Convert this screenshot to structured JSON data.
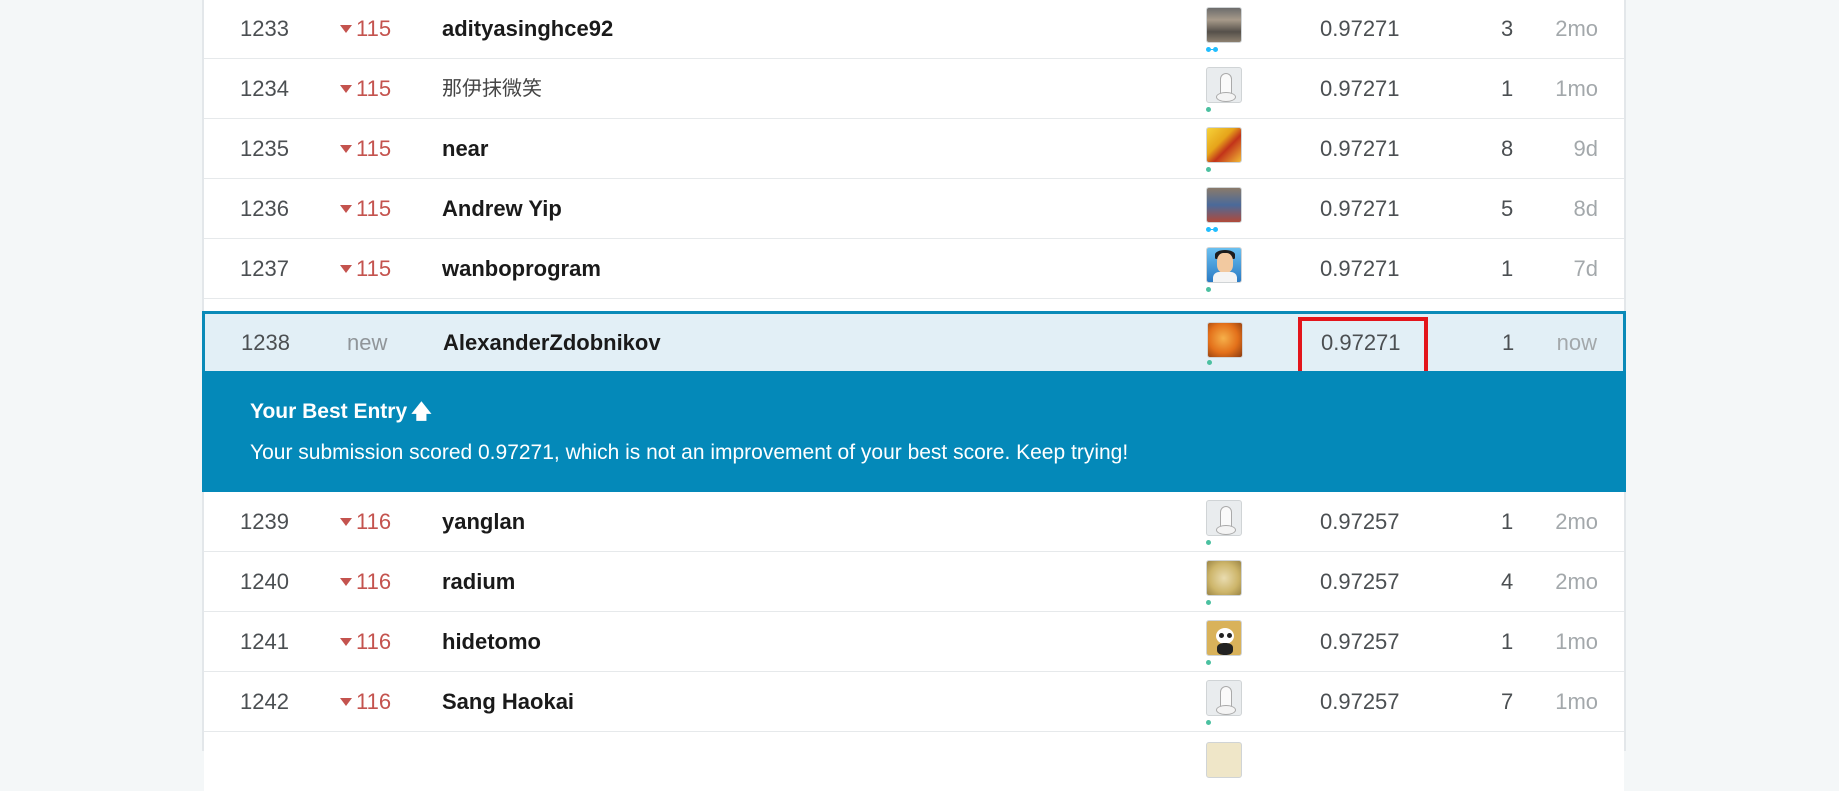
{
  "rows": [
    {
      "rank": "1233",
      "change": "115",
      "name": "adityasinghce92",
      "score": "0.97271",
      "entries": "3",
      "last": "2mo"
    },
    {
      "rank": "1234",
      "change": "115",
      "name": "那伊抹微笑",
      "score": "0.97271",
      "entries": "1",
      "last": "1mo"
    },
    {
      "rank": "1235",
      "change": "115",
      "name": "near",
      "score": "0.97271",
      "entries": "8",
      "last": "9d"
    },
    {
      "rank": "1236",
      "change": "115",
      "name": "Andrew Yip",
      "score": "0.97271",
      "entries": "5",
      "last": "8d"
    },
    {
      "rank": "1237",
      "change": "115",
      "name": "wanboprogram",
      "score": "0.97271",
      "entries": "1",
      "last": "7d"
    },
    {
      "rank": "1238",
      "change": "new",
      "name": "AlexanderZdobnikov",
      "score": "0.97271",
      "entries": "1",
      "last": "now"
    },
    {
      "rank": "1239",
      "change": "116",
      "name": "yanglan",
      "score": "0.97257",
      "entries": "1",
      "last": "2mo"
    },
    {
      "rank": "1240",
      "change": "116",
      "name": "radium",
      "score": "0.97257",
      "entries": "4",
      "last": "2mo"
    },
    {
      "rank": "1241",
      "change": "116",
      "name": "hidetomo",
      "score": "0.97257",
      "entries": "1",
      "last": "1mo"
    },
    {
      "rank": "1242",
      "change": "116",
      "name": "Sang Haokai",
      "score": "0.97257",
      "entries": "7",
      "last": "1mo"
    }
  ],
  "best_entry": {
    "title": "Your Best Entry",
    "message": "Your submission scored 0.97271, which is not an improvement of your best score. Keep trying!"
  },
  "colors": {
    "accent": "#0489b9",
    "highlight_border": "#e3151b",
    "rank_down": "#c4534e",
    "my_row_bg": "#e2eff6"
  }
}
